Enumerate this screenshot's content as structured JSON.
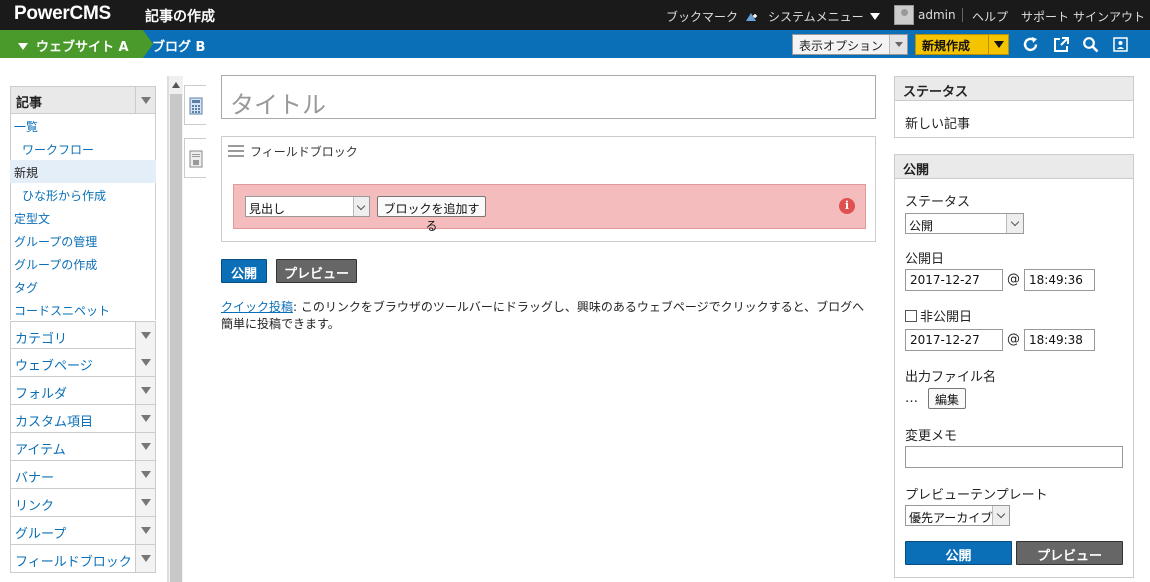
{
  "app": {
    "logo": "PowerCMS",
    "page_title": "記事の作成"
  },
  "topnav": {
    "bookmark": "ブックマーク",
    "system_menu": "システムメニュー",
    "user": "admin",
    "help": "ヘルプ",
    "support": "サポート",
    "signout": "サインアウト"
  },
  "breadcrumb": {
    "website": "ウェブサイト A",
    "blog": "ブログ B"
  },
  "toolbar": {
    "view_options": "表示オプション",
    "new_create": "新規作成"
  },
  "sidebar": {
    "head": "記事",
    "items": [
      {
        "label": "一覧",
        "indent": false,
        "active": false
      },
      {
        "label": "ワークフロー",
        "indent": true,
        "active": false
      },
      {
        "label": "新規",
        "indent": false,
        "active": true
      },
      {
        "label": "ひな形から作成",
        "indent": true,
        "active": false
      },
      {
        "label": "定型文",
        "indent": false,
        "active": false
      },
      {
        "label": "グループの管理",
        "indent": false,
        "active": false
      },
      {
        "label": "グループの作成",
        "indent": false,
        "active": false
      },
      {
        "label": "タグ",
        "indent": false,
        "active": false
      },
      {
        "label": "コードスニペット",
        "indent": false,
        "active": false
      }
    ],
    "categories": [
      "カテゴリ",
      "ウェブページ",
      "フォルダ",
      "カスタム項目",
      "アイテム",
      "バナー",
      "リンク",
      "グループ",
      "フィールドブロック"
    ]
  },
  "editor": {
    "title_placeholder": "タイトル",
    "field_block_title": "フィールドブロック",
    "heading_select": "見出し",
    "add_block": "ブロックを追加する",
    "publish": "公開",
    "preview": "プレビュー",
    "quick_link": "クイック投稿",
    "quick_text": ": このリンクをブラウザのツールバーにドラッグし、興味のあるウェブページでクリックすると、ブログへ簡単に投稿できます。"
  },
  "status_panel": {
    "title": "ステータス",
    "value": "新しい記事"
  },
  "publish_panel": {
    "title": "公開",
    "status_label": "ステータス",
    "status_value": "公開",
    "publish_date_label": "公開日",
    "publish_date": "2017-12-27",
    "publish_time": "18:49:36",
    "unpublish_label": "非公開日",
    "unpublish_date": "2017-12-27",
    "unpublish_time": "18:49:38",
    "at": "@",
    "filename_label": "出力ファイル名",
    "filename_value": "…",
    "edit": "編集",
    "memo_label": "変更メモ",
    "memo_value": "",
    "template_label": "プレビューテンプレート",
    "template_value": "優先アーカイブ",
    "publish": "公開",
    "preview": "プレビュー"
  },
  "colors": {
    "blue": "#0b6fb7",
    "green": "#4a9a2b",
    "yellow": "#f5c400",
    "alert": "#f4bcbc"
  }
}
